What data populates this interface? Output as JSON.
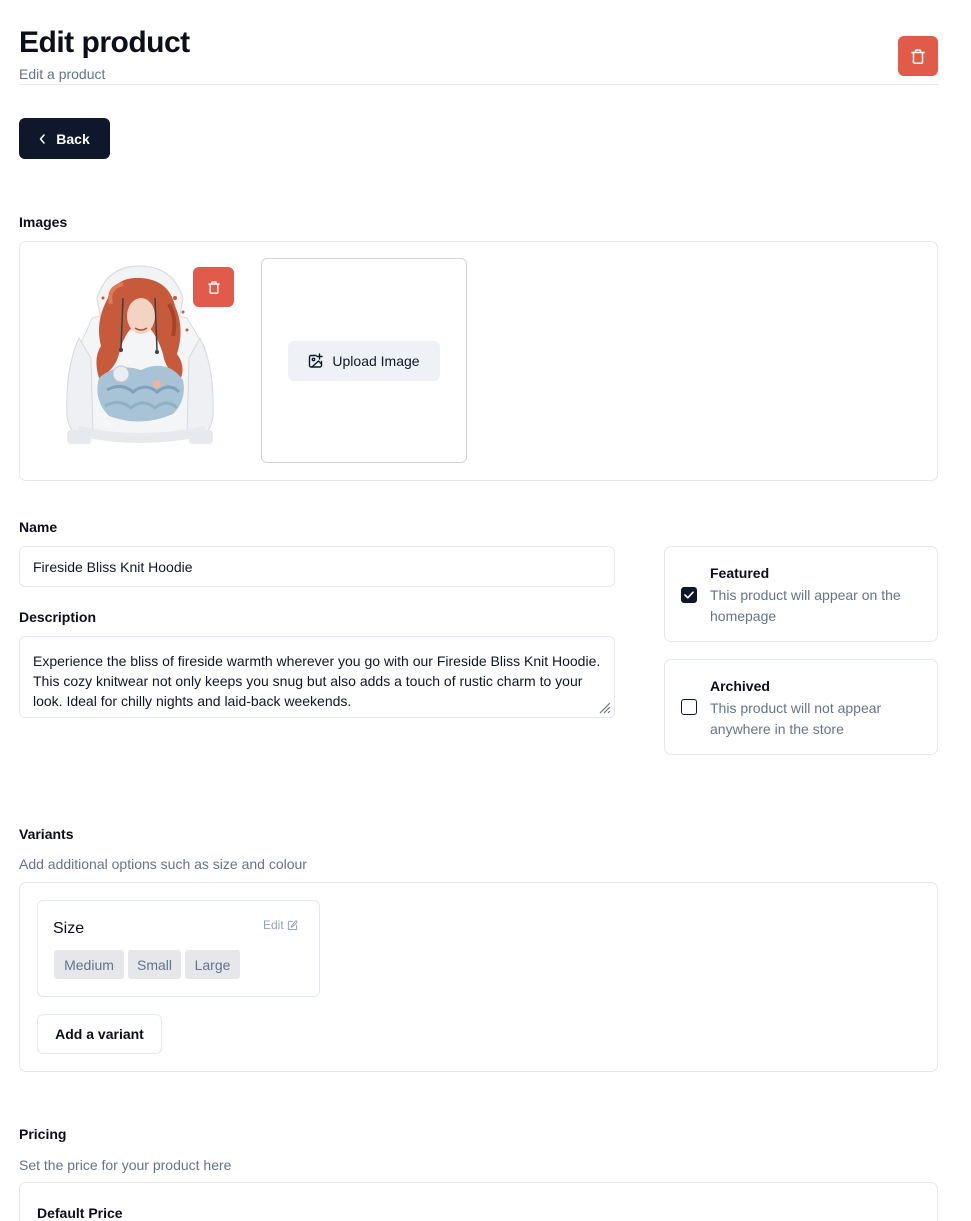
{
  "header": {
    "title": "Edit product",
    "subtitle": "Edit a product",
    "delete_icon": "trash-icon",
    "accent_color": "#e15a4a"
  },
  "back_button": {
    "label": "Back",
    "icon": "chevron-left-icon"
  },
  "images": {
    "label": "Images",
    "upload_label": "Upload Image",
    "upload_icon": "image-plus-icon"
  },
  "form": {
    "name_label": "Name",
    "name_value": "Fireside Bliss Knit Hoodie",
    "description_label": "Description",
    "description_value": "Experience the bliss of fireside warmth wherever you go with our Fireside Bliss Knit Hoodie. This cozy knitwear not only keeps you snug but also adds a touch of rustic charm to your look. Ideal for chilly nights and laid-back weekends."
  },
  "featured": {
    "title": "Featured",
    "description": "This product will appear on the homepage",
    "checked": true
  },
  "archived": {
    "title": "Archived",
    "description": "This product will not appear anywhere in the store",
    "checked": false
  },
  "variants": {
    "label": "Variants",
    "description": "Add additional options such as size and colour",
    "items": [
      {
        "name": "Size",
        "edit_label": "Edit",
        "options": [
          "Medium",
          "Small",
          "Large"
        ]
      }
    ],
    "add_label": "Add a variant"
  },
  "pricing": {
    "label": "Pricing",
    "description": "Set the price for your product here",
    "default_price_label": "Default Price"
  }
}
